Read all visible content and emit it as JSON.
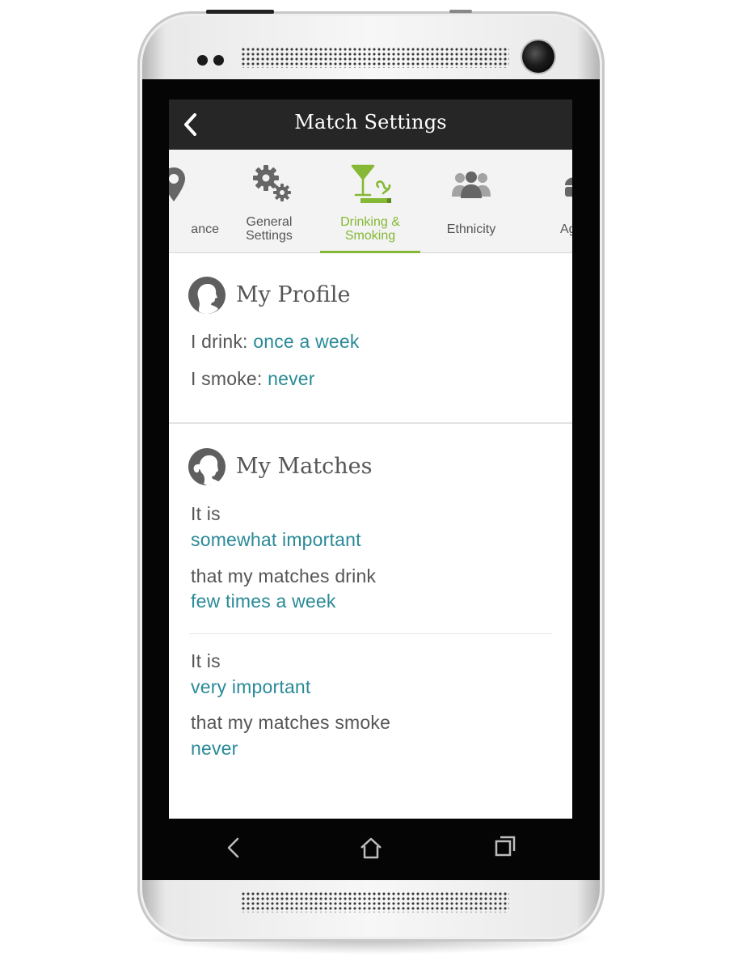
{
  "app": {
    "title": "Match Settings"
  },
  "tabs": [
    {
      "label": "ance",
      "icon": "location-pin-icon"
    },
    {
      "label_line1": "General",
      "label_line2": "Settings",
      "icon": "gears-icon"
    },
    {
      "label_line1": "Drinking &",
      "label_line2": "Smoking",
      "icon": "drinking-smoking-icon",
      "active": true
    },
    {
      "label": "Ethnicity",
      "icon": "people-group-icon"
    },
    {
      "label": "Ag",
      "icon": "age-icon"
    }
  ],
  "profile": {
    "title": "My Profile",
    "drink_prefix": "I drink: ",
    "drink_value": "once a week",
    "smoke_prefix": "I smoke: ",
    "smoke_value": "never"
  },
  "matches": {
    "title": "My Matches",
    "drink_pref": {
      "prefix": "It is",
      "importance": "somewhat important",
      "middle": "that my matches drink",
      "value": "few times a week"
    },
    "smoke_pref": {
      "prefix": "It is",
      "importance": "very important",
      "middle": "that my matches smoke",
      "value": "never"
    }
  },
  "colors": {
    "accent_green": "#85b834",
    "value_teal": "#2a8a98",
    "appbar": "#262626"
  }
}
